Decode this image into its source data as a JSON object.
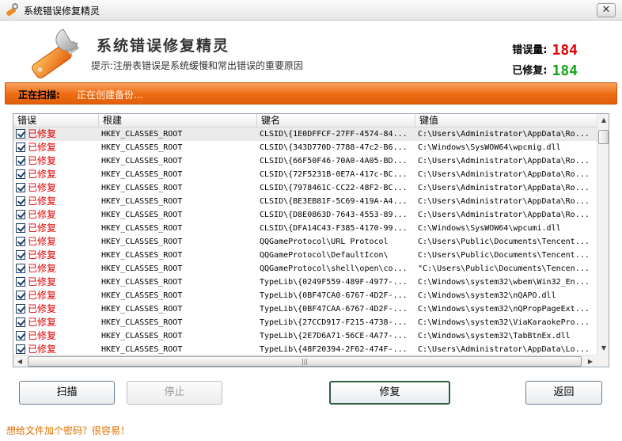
{
  "window": {
    "title": "系统错误修复精灵",
    "close_glyph": "✕"
  },
  "header": {
    "app_name": "系统错误修复精灵",
    "hint": "提示:注册表错误是系统缓慢和常出错误的重要原因",
    "error_count_label": "错误量:",
    "error_count": "184",
    "fixed_count_label": "已修复:",
    "fixed_count": "184"
  },
  "scan": {
    "label": "正在扫描:",
    "status": "正在创建备份..."
  },
  "table": {
    "columns": [
      "错误",
      "根建",
      "键名",
      "键值"
    ],
    "rows": [
      [
        "已修复",
        "HKEY_CLASSES_ROOT",
        "CLSID\\{1E0DFFCF-27FF-4574-84...",
        "C:\\Users\\Administrator\\AppData\\Ro..."
      ],
      [
        "已修复",
        "HKEY_CLASSES_ROOT",
        "CLSID\\{343D770D-7788-47c2-B6...",
        "C:\\Windows\\SysWOW64\\wpcmig.dll"
      ],
      [
        "已修复",
        "HKEY_CLASSES_ROOT",
        "CLSID\\{66F50F46-70A0-4A05-BD...",
        "C:\\Users\\Administrator\\AppData\\Ro..."
      ],
      [
        "已修复",
        "HKEY_CLASSES_ROOT",
        "CLSID\\{72F5231B-0E7A-417c-BC...",
        "C:\\Users\\Administrator\\AppData\\Ro..."
      ],
      [
        "已修复",
        "HKEY_CLASSES_ROOT",
        "CLSID\\{7978461C-CC22-48F2-BC...",
        "C:\\Users\\Administrator\\AppData\\Ro..."
      ],
      [
        "已修复",
        "HKEY_CLASSES_ROOT",
        "CLSID\\{BE3EB81F-5C69-419A-A4...",
        "C:\\Users\\Administrator\\AppData\\Ro..."
      ],
      [
        "已修复",
        "HKEY_CLASSES_ROOT",
        "CLSID\\{D8E0863D-7643-4553-89...",
        "C:\\Users\\Administrator\\AppData\\Ro..."
      ],
      [
        "已修复",
        "HKEY_CLASSES_ROOT",
        "CLSID\\{DFA14C43-F385-4170-99...",
        "C:\\Windows\\SysWOW64\\wpcumi.dll"
      ],
      [
        "已修复",
        "HKEY_CLASSES_ROOT",
        "QQGameProtocol\\URL Protocol",
        "C:\\Users\\Public\\Documents\\Tencent..."
      ],
      [
        "已修复",
        "HKEY_CLASSES_ROOT",
        "QQGameProtocol\\DefaultIcon\\",
        "C:\\Users\\Public\\Documents\\Tencent..."
      ],
      [
        "已修复",
        "HKEY_CLASSES_ROOT",
        "QQGameProtocol\\shell\\open\\co...",
        "\"C:\\Users\\Public\\Documents\\Tencen..."
      ],
      [
        "已修复",
        "HKEY_CLASSES_ROOT",
        "TypeLib\\{0249F559-489F-4977-...",
        "C:\\Windows\\system32\\wbem\\Win32_En..."
      ],
      [
        "已修复",
        "HKEY_CLASSES_ROOT",
        "TypeLib\\{0BF47CA0-6767-4D2F-...",
        "C:\\Windows\\system32\\nQAPO.dll"
      ],
      [
        "已修复",
        "HKEY_CLASSES_ROOT",
        "TypeLib\\{0BF47CAA-6767-4D2F-...",
        "C:\\Windows\\system32\\nQPropPageExt..."
      ],
      [
        "已修复",
        "HKEY_CLASSES_ROOT",
        "TypeLib\\{27CCD917-F215-4738-...",
        "C:\\Windows\\system32\\ViaKaraokePro..."
      ],
      [
        "已修复",
        "HKEY_CLASSES_ROOT",
        "TypeLib\\{2E7D6A71-56CE-4A77-...",
        "C:\\Windows\\system32\\TabBtnEx.dll"
      ],
      [
        "已修复",
        "HKEY_CLASSES_ROOT",
        "TypeLib\\{48F20394-2F62-474F-...",
        "C:\\Users\\Administrator\\AppData\\Lo..."
      ]
    ]
  },
  "buttons": {
    "scan": "扫描",
    "stop": "停止",
    "repair": "修复",
    "back": "返回"
  },
  "footer": {
    "link": "想给文件加个密码？很容易！"
  },
  "colors": {
    "accent": "#ee6a12",
    "error_red": "#e00000",
    "fixed_green": "#1aa61a",
    "link_orange": "#e07000"
  }
}
